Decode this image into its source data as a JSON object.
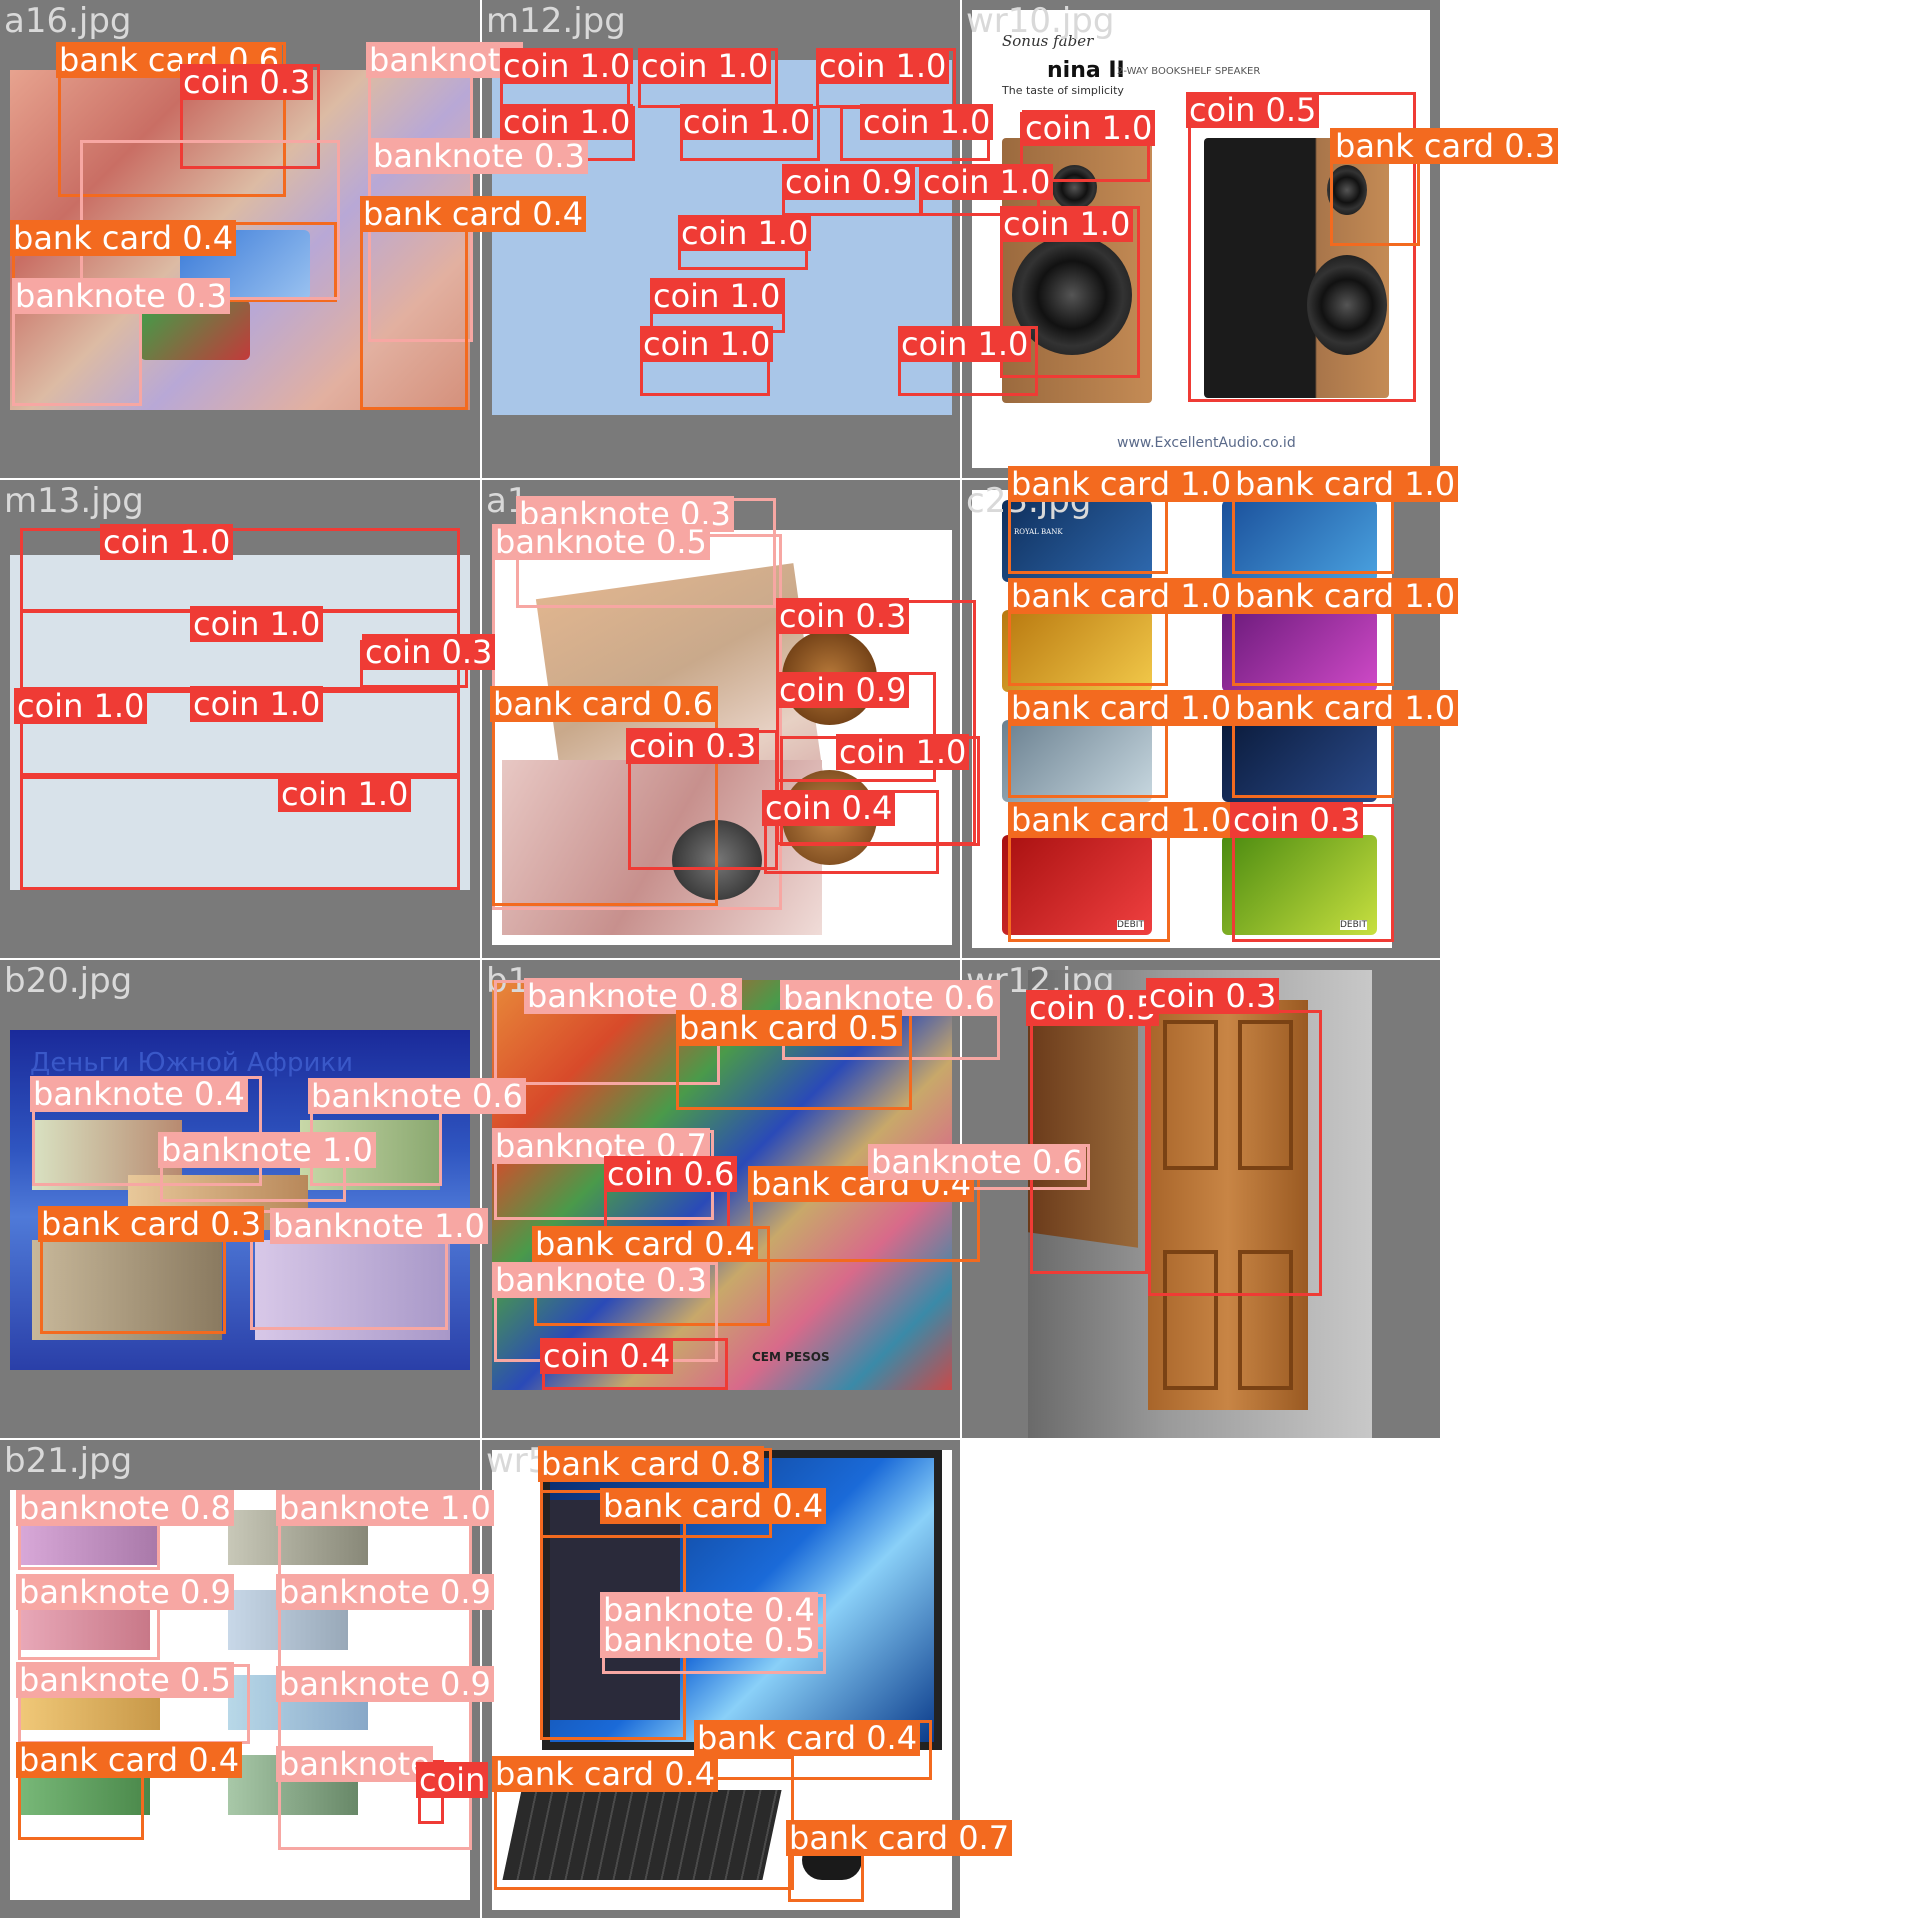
{
  "colors": {
    "bank_card": "#f36a1f",
    "banknote": "#f7a7a3",
    "coin": "#ef3b35",
    "tile_bg": "#7a7a7a",
    "tile_name": "#d9d9d9"
  },
  "tiles": [
    {
      "name": "a16.jpg"
    },
    {
      "name": "m12.jpg"
    },
    {
      "name": "wr10.jpg"
    },
    {
      "name": "m13.jpg"
    },
    {
      "name": "a1"
    },
    {
      "name": "c23.jpg"
    },
    {
      "name": "b20.jpg"
    },
    {
      "name": "b1"
    },
    {
      "name": "wr12.jpg"
    },
    {
      "name": "b21.jpg"
    },
    {
      "name": "wr5"
    }
  ],
  "photo_text": {
    "speaker_brand": "Sonus faber",
    "speaker_model": "nina II",
    "speaker_subtitle": "2-WAY BOOKSHELF SPEAKER",
    "speaker_tagline": "The taste of simplicity",
    "speaker_url": "www.ExcellentAudio.co.id",
    "b20_title": "Деньги Южной Африки",
    "bank_name": "ROYAL BANK",
    "debit": "DEBIT",
    "cem_pesos": "CEM PESOS"
  },
  "labels": [
    {
      "text": "bank card 0.6",
      "cls": "bank"
    },
    {
      "text": "banknote",
      "cls": "banknote"
    },
    {
      "text": "coin 0.3",
      "cls": "coin"
    },
    {
      "text": "bank card 0.4",
      "cls": "bank"
    },
    {
      "text": "banknote 0.3",
      "cls": "banknote"
    },
    {
      "text": "bank card 0.4",
      "cls": "bank"
    },
    {
      "text": "banknote 0.3",
      "cls": "banknote"
    },
    {
      "text": "coin 1.0",
      "cls": "coin"
    },
    {
      "text": "coin 1.0",
      "cls": "coin"
    },
    {
      "text": "coin 1.0",
      "cls": "coin"
    },
    {
      "text": "coin 1.0",
      "cls": "coin"
    },
    {
      "text": "coin 1.0",
      "cls": "coin"
    },
    {
      "text": "coin 1.0",
      "cls": "coin"
    },
    {
      "text": "coin 0.9",
      "cls": "coin"
    },
    {
      "text": "coin 1.0",
      "cls": "coin"
    },
    {
      "text": "coin 1.0",
      "cls": "coin"
    },
    {
      "text": "coin 1.0",
      "cls": "coin"
    },
    {
      "text": "coin 1.0",
      "cls": "coin"
    },
    {
      "text": "coin 1.0",
      "cls": "coin"
    },
    {
      "text": "coin 0.5",
      "cls": "coin"
    },
    {
      "text": "bank card 0.3",
      "cls": "bank"
    },
    {
      "text": "coin 1.0",
      "cls": "coin"
    },
    {
      "text": "coin 1.0",
      "cls": "coin"
    },
    {
      "text": "coin 1.0",
      "cls": "coin"
    },
    {
      "text": "coin 1.0",
      "cls": "coin"
    },
    {
      "text": "coin 0.3",
      "cls": "coin"
    },
    {
      "text": "coin 1.0",
      "cls": "coin"
    },
    {
      "text": "coin 1.0",
      "cls": "coin"
    },
    {
      "text": "coin 1.0",
      "cls": "coin"
    },
    {
      "text": "banknote 0.3",
      "cls": "banknote"
    },
    {
      "text": "banknote 0.5",
      "cls": "banknote"
    },
    {
      "text": "coin 0.3",
      "cls": "coin"
    },
    {
      "text": "bank card 0.6",
      "cls": "bank"
    },
    {
      "text": "coin 0.9",
      "cls": "coin"
    },
    {
      "text": "coin 0.3",
      "cls": "coin"
    },
    {
      "text": "coin 1.0",
      "cls": "coin"
    },
    {
      "text": "coin 0.4",
      "cls": "coin"
    },
    {
      "text": "bank card 1.0",
      "cls": "bank"
    },
    {
      "text": "bank card 1.0",
      "cls": "bank"
    },
    {
      "text": "bank card 1.0",
      "cls": "bank"
    },
    {
      "text": "bank card 1.0",
      "cls": "bank"
    },
    {
      "text": "bank card 1.0",
      "cls": "bank"
    },
    {
      "text": "bank card 1.0",
      "cls": "bank"
    },
    {
      "text": "bank card 1.0",
      "cls": "bank"
    },
    {
      "text": "coin 0.3",
      "cls": "coin"
    },
    {
      "text": "banknote 0.4",
      "cls": "banknote"
    },
    {
      "text": "banknote 0.6",
      "cls": "banknote"
    },
    {
      "text": "banknote 1.0",
      "cls": "banknote"
    },
    {
      "text": "bank card 0.3",
      "cls": "bank"
    },
    {
      "text": "banknote 1.0",
      "cls": "banknote"
    },
    {
      "text": "banknote 0.8",
      "cls": "banknote"
    },
    {
      "text": "banknote 0.6",
      "cls": "banknote"
    },
    {
      "text": "bank card 0.5",
      "cls": "bank"
    },
    {
      "text": "banknote 0.7",
      "cls": "banknote"
    },
    {
      "text": "coin 0.6",
      "cls": "coin"
    },
    {
      "text": "bank card 0.4",
      "cls": "bank"
    },
    {
      "text": "banknote 0.6",
      "cls": "banknote"
    },
    {
      "text": "bank card 0.4",
      "cls": "bank"
    },
    {
      "text": "banknote 0.3",
      "cls": "banknote"
    },
    {
      "text": "coin 0.4",
      "cls": "coin"
    },
    {
      "text": "coin 0.5",
      "cls": "coin"
    },
    {
      "text": "coin 0.3",
      "cls": "coin"
    },
    {
      "text": "banknote 0.8",
      "cls": "banknote"
    },
    {
      "text": "banknote 1.0",
      "cls": "banknote"
    },
    {
      "text": "banknote 0.9",
      "cls": "banknote"
    },
    {
      "text": "banknote 0.9",
      "cls": "banknote"
    },
    {
      "text": "banknote 0.5",
      "cls": "banknote"
    },
    {
      "text": "banknote 0.9",
      "cls": "banknote"
    },
    {
      "text": "bank card 0.4",
      "cls": "bank"
    },
    {
      "text": "banknote",
      "cls": "banknote"
    },
    {
      "text": "coin",
      "cls": "coin"
    },
    {
      "text": "bank card 0.8",
      "cls": "bank"
    },
    {
      "text": "bank card 0.4",
      "cls": "bank"
    },
    {
      "text": "banknote 0.4",
      "cls": "banknote"
    },
    {
      "text": "banknote 0.5",
      "cls": "banknote"
    },
    {
      "text": "bank card 0.4",
      "cls": "bank"
    },
    {
      "text": "bank card 0.4",
      "cls": "bank"
    },
    {
      "text": "bank card 0.7",
      "cls": "bank"
    }
  ]
}
